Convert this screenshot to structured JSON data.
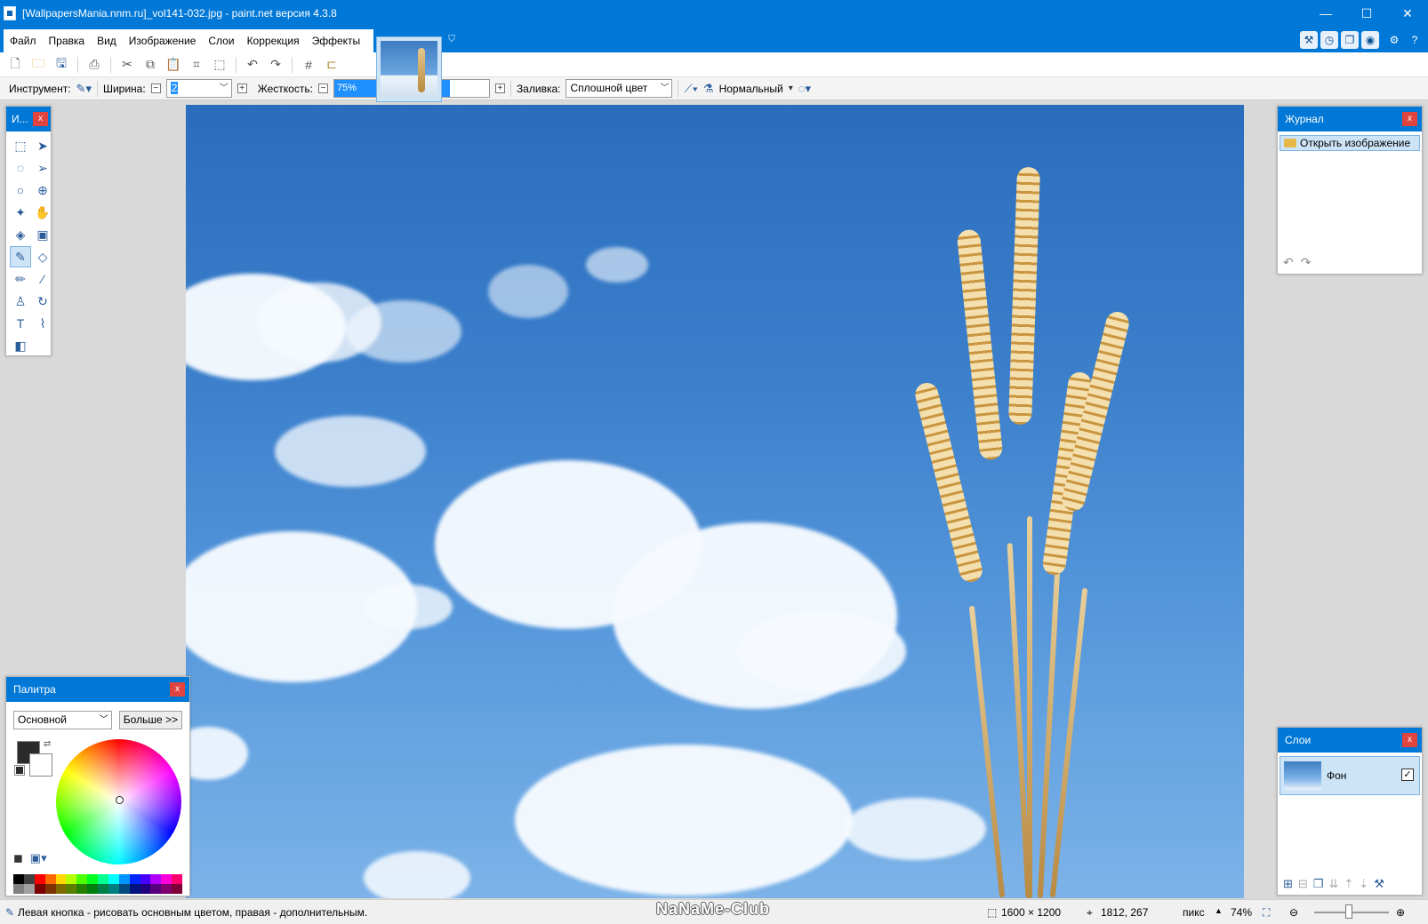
{
  "window": {
    "title": "[WallpapersMania.nnm.ru]_vol141-032.jpg - paint.net версия 4.3.8",
    "controls": {
      "minimize": "—",
      "maximize": "☐",
      "close": "✕"
    }
  },
  "menu": {
    "items": [
      "Файл",
      "Правка",
      "Вид",
      "Изображение",
      "Слои",
      "Коррекция",
      "Эффекты"
    ]
  },
  "toolbar_icons": [
    "new-icon",
    "open-icon",
    "save-icon",
    "print-icon",
    "cut-icon",
    "copy-icon",
    "paste-icon",
    "crop-icon",
    "deselect-icon",
    "undo-icon",
    "redo-icon",
    "grid-icon",
    "ruler-icon"
  ],
  "props": {
    "tool_label": "Инструмент:",
    "width_label": "Ширина:",
    "width_value": "2",
    "hardness_label": "Жесткость:",
    "hardness_value": "75%",
    "hardness_fraction": 0.75,
    "fill_label": "Заливка:",
    "fill_value": "Сплошной цвет",
    "blend_value": "Нормальный"
  },
  "tools_panel": {
    "title": "И...",
    "close": "x",
    "tools": [
      {
        "name": "rectangle-select-icon",
        "glyph": "⬚",
        "active": false
      },
      {
        "name": "move-selection-icon",
        "glyph": "➤",
        "active": false
      },
      {
        "name": "lasso-select-icon",
        "glyph": "◌",
        "active": false
      },
      {
        "name": "move-selected-icon",
        "glyph": "➢",
        "active": false
      },
      {
        "name": "ellipse-select-icon",
        "glyph": "○",
        "active": false
      },
      {
        "name": "zoom-icon",
        "glyph": "⊕",
        "active": false
      },
      {
        "name": "magic-wand-icon",
        "glyph": "✦",
        "active": false
      },
      {
        "name": "pan-icon",
        "glyph": "✋",
        "active": false
      },
      {
        "name": "paint-bucket-icon",
        "glyph": "◈",
        "active": false
      },
      {
        "name": "gradient-icon",
        "glyph": "▣",
        "active": false
      },
      {
        "name": "paintbrush-icon",
        "glyph": "✎",
        "active": true
      },
      {
        "name": "eraser-icon",
        "glyph": "◇",
        "active": false
      },
      {
        "name": "pencil-icon",
        "glyph": "✏",
        "active": false
      },
      {
        "name": "color-picker-icon",
        "glyph": "⁄",
        "active": false
      },
      {
        "name": "clone-stamp-icon",
        "glyph": "♙",
        "active": false
      },
      {
        "name": "recolor-icon",
        "glyph": "↻",
        "active": false
      },
      {
        "name": "text-icon",
        "glyph": "T",
        "active": false
      },
      {
        "name": "line-curve-icon",
        "glyph": "⌇",
        "active": false
      },
      {
        "name": "shapes-icon",
        "glyph": "◧",
        "active": false
      }
    ]
  },
  "history_panel": {
    "title": "Журнал",
    "close": "x",
    "items": [
      "Открыть изображение"
    ]
  },
  "layers_panel": {
    "title": "Слои",
    "close": "x",
    "layers": [
      {
        "name": "Фон",
        "visible": "✓"
      }
    ]
  },
  "palette_panel": {
    "title": "Палитра",
    "close": "x",
    "palette_select": "Основной",
    "more_button": "Больше >>",
    "primary_color": "#2b2b2b",
    "secondary_color": "#ffffff",
    "swatches": [
      "#000000",
      "#404040",
      "#ff0000",
      "#ff6a00",
      "#ffd800",
      "#b6ff00",
      "#4cff00",
      "#00ff21",
      "#00ff90",
      "#00ffff",
      "#0094ff",
      "#0026ff",
      "#4800ff",
      "#b200ff",
      "#ff00dc",
      "#ff006e",
      "#808080",
      "#a0a0a0",
      "#7f0000",
      "#7f3300",
      "#7f6a00",
      "#5b7f00",
      "#267f00",
      "#007f0e",
      "#007f46",
      "#007f7f",
      "#004a7f",
      "#00137f",
      "#21007f",
      "#57007f",
      "#7f006e",
      "#7f0037"
    ]
  },
  "status": {
    "hint": "Левая кнопка - рисовать основным цветом, правая - дополнительным.",
    "watermark": "NaNaMe-Club",
    "image_size": "1600 × 1200",
    "cursor_pos": "1812, 267",
    "units": "пикс",
    "zoom": "74%"
  },
  "accent_color": "#0078d7"
}
